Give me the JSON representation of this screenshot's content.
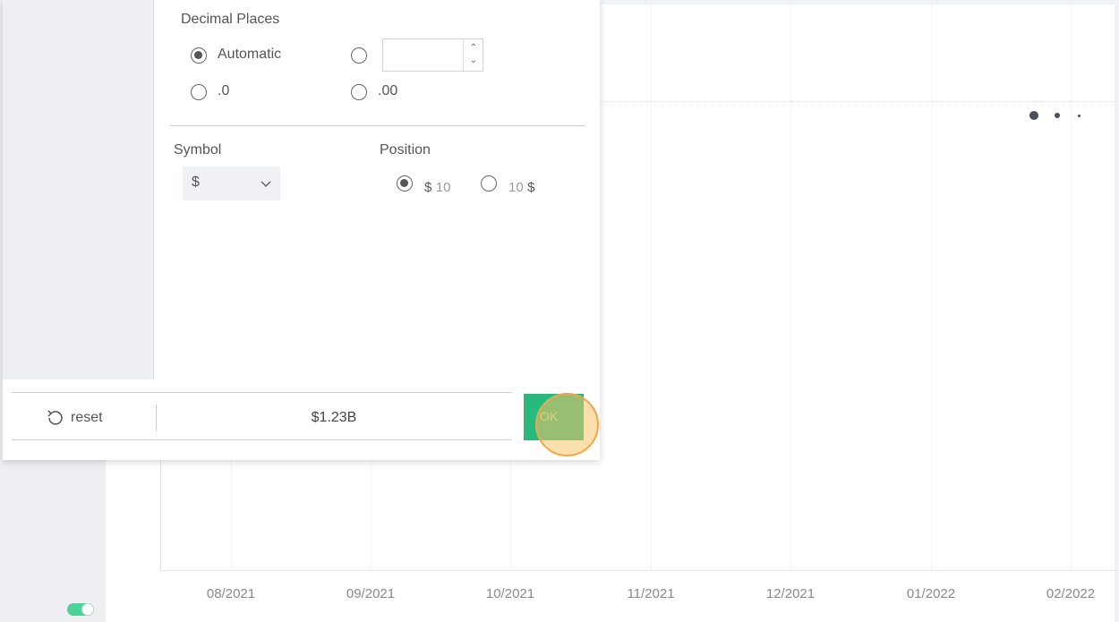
{
  "chart": {
    "x_ticks": [
      "08/2021",
      "09/2021",
      "10/2021",
      "11/2021",
      "12/2021",
      "01/2022",
      "02/2022"
    ],
    "more_icon": "ellipsis-icon"
  },
  "dialog": {
    "decimal_places": {
      "title": "Decimal Places",
      "options": [
        "Automatic",
        ".0",
        ".00"
      ],
      "custom_value": "",
      "selected": "Automatic"
    },
    "symbol": {
      "title": "Symbol",
      "value": "$"
    },
    "position": {
      "title": "Position",
      "options": [
        {
          "symbol": "$",
          "number": "10",
          "selected": true
        },
        {
          "symbol": "$",
          "number": "10",
          "selected": false
        }
      ]
    },
    "footer": {
      "reset_label": "reset",
      "preview": "$1.23B",
      "ok_label": "OK"
    }
  },
  "colors": {
    "accent_green": "#27ba7c",
    "toggle_on": "#4cd196",
    "cursor_highlight": "#f6c367"
  }
}
